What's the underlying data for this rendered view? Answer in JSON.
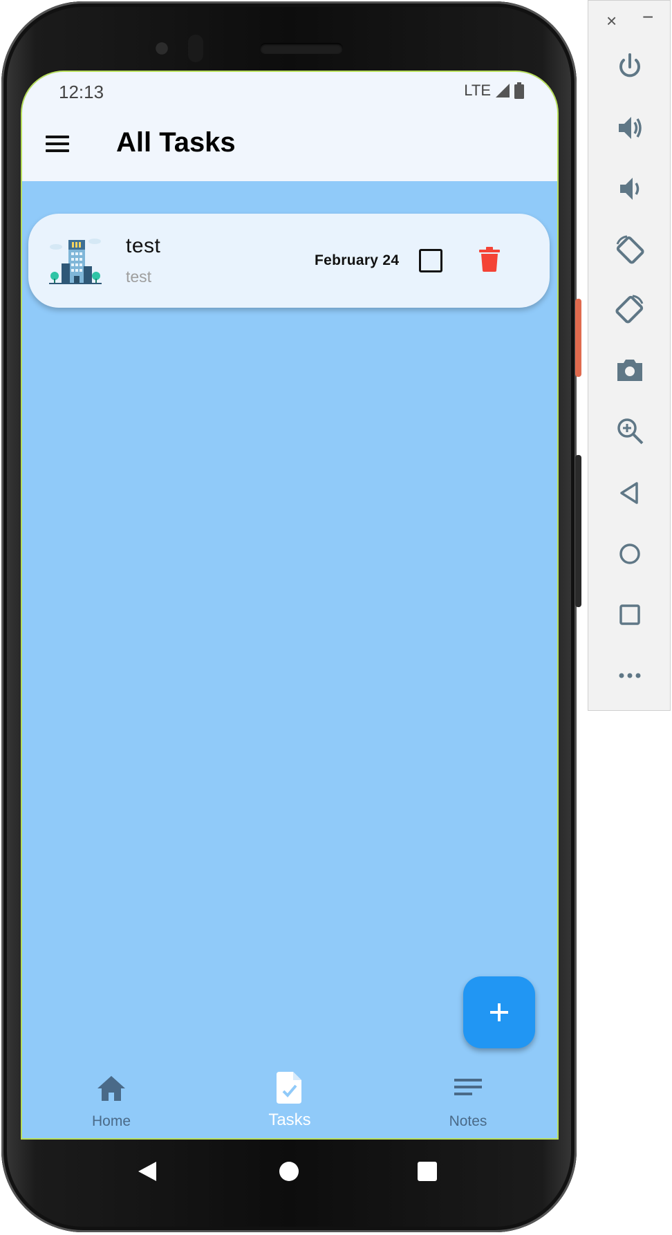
{
  "status_bar": {
    "time": "12:13",
    "network": "LTE",
    "icons": [
      "signal-icon",
      "battery-icon"
    ]
  },
  "app_bar": {
    "title": "All Tasks",
    "menu_icon": "menu-icon"
  },
  "tasks": [
    {
      "title": "test",
      "subtitle": "test",
      "date": "February 24",
      "completed": false,
      "thumbnail_icon": "building-icon",
      "delete_icon": "trash-icon"
    }
  ],
  "fab": {
    "icon": "plus-icon"
  },
  "bottom_nav": {
    "items": [
      {
        "label": "Home",
        "icon": "home-icon",
        "active": false
      },
      {
        "label": "Tasks",
        "icon": "task-document-icon",
        "active": true
      },
      {
        "label": "Notes",
        "icon": "notes-icon",
        "active": false
      }
    ]
  },
  "system_nav": {
    "icons": [
      "back-icon",
      "home-circle-icon",
      "recents-icon"
    ]
  },
  "emulator_panel": {
    "close_label": "×",
    "minimize_label": "−",
    "buttons": [
      "power-icon",
      "volume-up-icon",
      "volume-down-icon",
      "rotate-left-icon",
      "rotate-right-icon",
      "camera-icon",
      "zoom-icon",
      "back-icon",
      "home-icon",
      "overview-icon",
      "more-icon"
    ]
  },
  "colors": {
    "screen_bg": "#90caf9",
    "app_bar_bg": "#f1f6fd",
    "card_bg": "#e9f3fd",
    "fab": "#2196f3",
    "delete": "#f44336",
    "nav_inactive": "#4a6a88",
    "nav_active": "#ffffff"
  }
}
